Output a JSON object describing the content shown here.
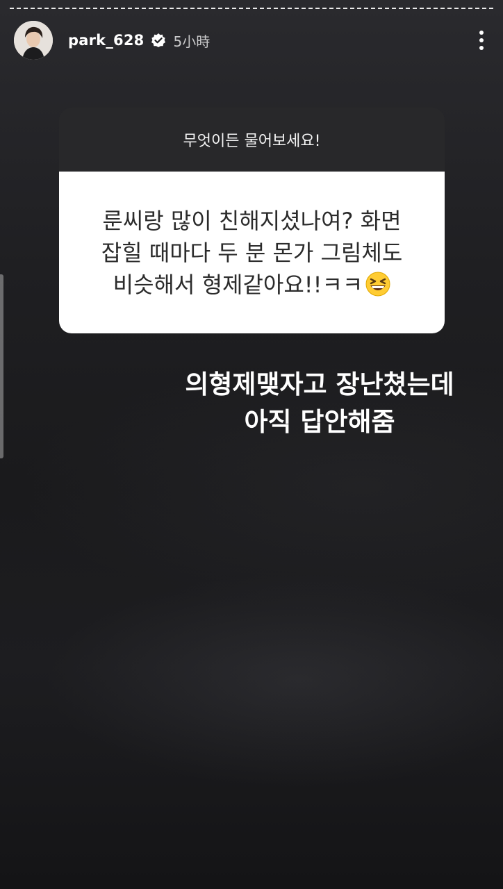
{
  "story": {
    "progress": {
      "segments": 1,
      "current": 1
    },
    "header": {
      "username": "park_628",
      "verified": true,
      "time": "5小時",
      "avatar_icon": "user-avatar",
      "more_icon": "more-vertical-icon"
    },
    "question_card": {
      "prompt": "무엇이든 물어보세요!",
      "question": "룬씨랑 많이 친해지셨나여? 화면\n잡힐 때마다 두 분 몬가 그림체도\n비슷해서 형제같아요!!ㅋㅋ",
      "emoji": "grinning-squinting-face"
    },
    "answer_text": "의형제맺자고 장난쳤는데\n아직 답안해줌"
  }
}
